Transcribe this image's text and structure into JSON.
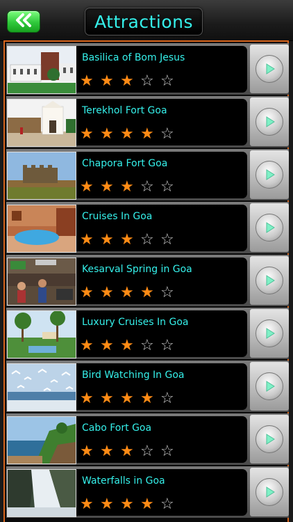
{
  "header": {
    "back_icon": "double-chevron-left-icon",
    "title": "Attractions"
  },
  "colors": {
    "accent": "#35f0ea",
    "star": "#ff8b15",
    "back_button": "#2fc93b",
    "list_border": "#d8651c"
  },
  "rows": [
    {
      "title": "Basilica of Bom Jesus",
      "rating": 3
    },
    {
      "title": "Terekhol Fort Goa",
      "rating": 4
    },
    {
      "title": "Chapora Fort Goa",
      "rating": 3
    },
    {
      "title": "Cruises In Goa",
      "rating": 3
    },
    {
      "title": "Kesarval Spring in Goa",
      "rating": 4
    },
    {
      "title": "Luxury Cruises In Goa",
      "rating": 3
    },
    {
      "title": "Bird Watching In Goa",
      "rating": 4
    },
    {
      "title": "Cabo Fort Goa",
      "rating": 3
    },
    {
      "title": "Waterfalls in Goa",
      "rating": 4
    }
  ]
}
